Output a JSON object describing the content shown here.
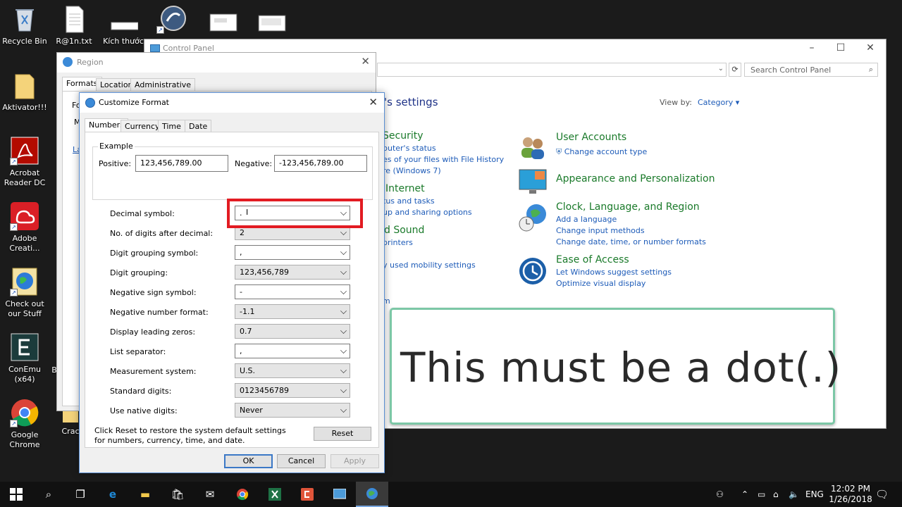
{
  "desktop": {
    "icons": [
      {
        "label": "Recycle Bin"
      },
      {
        "label": "R@1n.txt"
      },
      {
        "label": "Kích thước"
      },
      {
        "label": "Aktivator!!!"
      },
      {
        "label": "Acrobat Reader DC"
      },
      {
        "label": "Adobe Creati..."
      },
      {
        "label": "Check out our Stuff"
      },
      {
        "label": "ConEmu (x64)"
      },
      {
        "label": "Google Chrome"
      },
      {
        "label": "Crac"
      },
      {
        "label": "B"
      }
    ]
  },
  "control_panel": {
    "title": "Control Panel",
    "search_placeholder": "Search Control Panel",
    "heading": "'s settings",
    "view_by_label": "View by:",
    "view_by_value": "Category",
    "left_fragments": {
      "security_title": "Security",
      "security_link1": "puter's status",
      "security_link2": "es of your files with File History",
      "security_link3": "re (Windows 7)",
      "internet_title": "Internet",
      "internet_link1": "tus and tasks",
      "internet_link2": "up and sharing options",
      "sound_title": "d Sound",
      "sound_link1": "printers",
      "hardware_link": "y used mobility settings",
      "programs_link": "m"
    },
    "categories": [
      {
        "title": "User Accounts",
        "links": [
          "Change account type"
        ]
      },
      {
        "title": "Appearance and Personalization",
        "links": []
      },
      {
        "title": "Clock, Language, and Region",
        "links": [
          "Add a language",
          "Change input methods",
          "Change date, time, or number formats"
        ]
      },
      {
        "title": "Ease of Access",
        "links": [
          "Let Windows suggest settings",
          "Optimize visual display"
        ]
      }
    ]
  },
  "region": {
    "title": "Region",
    "tabs": [
      "Formats",
      "Location",
      "Administrative"
    ],
    "fragments": {
      "fo": "Fo",
      "m": "M",
      "la": "La"
    }
  },
  "customize": {
    "title": "Customize Format",
    "tabs": [
      "Numbers",
      "Currency",
      "Time",
      "Date"
    ],
    "example_label": "Example",
    "positive_label": "Positive:",
    "positive_value": "123,456,789.00",
    "negative_label": "Negative:",
    "negative_value": "-123,456,789.00",
    "rows": [
      {
        "label": "Decimal symbol:",
        "value": "."
      },
      {
        "label": "No. of digits after decimal:",
        "value": "2"
      },
      {
        "label": "Digit grouping symbol:",
        "value": ","
      },
      {
        "label": "Digit grouping:",
        "value": "123,456,789"
      },
      {
        "label": "Negative sign symbol:",
        "value": "-"
      },
      {
        "label": "Negative number format:",
        "value": "-1.1"
      },
      {
        "label": "Display leading zeros:",
        "value": "0.7"
      },
      {
        "label": "List separator:",
        "value": ","
      },
      {
        "label": "Measurement system:",
        "value": "U.S."
      },
      {
        "label": "Standard digits:",
        "value": "0123456789"
      },
      {
        "label": "Use native digits:",
        "value": "Never"
      }
    ],
    "reset_note": "Click Reset to restore the system default settings for numbers, currency, time, and date.",
    "reset_button": "Reset",
    "ok_button": "OK",
    "cancel_button": "Cancel",
    "apply_button": "Apply"
  },
  "callout": {
    "text": "This must be a dot(.)"
  },
  "taskbar": {
    "lang": "ENG",
    "time": "12:02 PM",
    "date": "1/26/2018"
  },
  "colors": {
    "highlight": "#e21b22",
    "callout_border": "#7cc7a6",
    "link": "#1d5bb8",
    "category": "#1a7a2a"
  }
}
